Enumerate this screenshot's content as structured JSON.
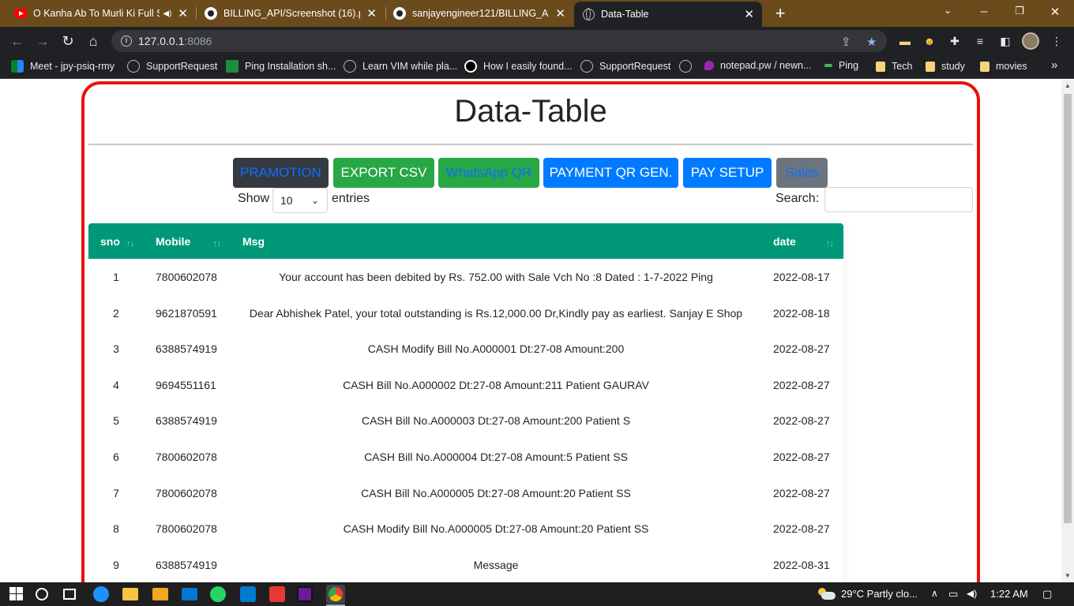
{
  "browser": {
    "tabs": [
      {
        "label": "O Kanha Ab To Murli Ki Full S",
        "icon": "youtube-icon",
        "audio": true
      },
      {
        "label": "BILLING_API/Screenshot (16).png",
        "icon": "github-icon"
      },
      {
        "label": "sanjayengineer121/BILLING_API",
        "icon": "github-icon"
      },
      {
        "label": "Data-Table",
        "icon": "globe-icon",
        "active": true
      }
    ],
    "new_tab": "+",
    "url_host": "127.0.0.1",
    "url_port": ":8086",
    "bookmarks": [
      {
        "label": "Meet - jpy-psiq-rmy",
        "icon": "meet-icon"
      },
      {
        "label": "SupportRequest",
        "icon": "globe-icon"
      },
      {
        "label": "Ping Installation sh...",
        "icon": "sheets-icon"
      },
      {
        "label": "Learn VIM while pla...",
        "icon": "globe-icon"
      },
      {
        "label": "How I easily found...",
        "icon": "medium-icon"
      },
      {
        "label": "SupportRequest",
        "icon": "globe-icon"
      },
      {
        "label": "notepad.pw / newn...",
        "icon": "notepad-icon"
      },
      {
        "label": "Ping",
        "icon": "ping-icon"
      },
      {
        "label": "Tech",
        "icon": "folder-icon"
      },
      {
        "label": "study",
        "icon": "folder-icon"
      },
      {
        "label": "movies",
        "icon": "folder-icon"
      }
    ],
    "more_bookmarks": "»"
  },
  "page": {
    "title": "Data-Table",
    "buttons": {
      "promotion": "PRAMOTION",
      "export_csv": "EXPORT CSV",
      "whatsapp_qr": "WhatsApp QR",
      "payment_qr": "PAYMENT QR GEN.",
      "pay_setup": "PAY SETUP",
      "sales": "Sales"
    },
    "length": {
      "show": "Show",
      "value": "10",
      "entries": "entries"
    },
    "search_label": "Search:",
    "table": {
      "headers": {
        "sno": "sno",
        "mobile": "Mobile",
        "msg": "Msg",
        "date": "date"
      },
      "rows": [
        {
          "sno": "1",
          "mobile": "7800602078",
          "msg": "Your account has been debited by Rs. 752.00 with Sale Vch No :8 Dated : 1-7-2022 Ping",
          "date": "2022-08-17"
        },
        {
          "sno": "2",
          "mobile": "9621870591",
          "msg": "Dear Abhishek Patel, your total outstanding is Rs.12,000.00 Dr,Kindly pay as earliest. Sanjay E Shop",
          "date": "2022-08-18"
        },
        {
          "sno": "3",
          "mobile": "6388574919",
          "msg": "CASH Modify Bill No.A000001 Dt:27-08 Amount:200",
          "date": "2022-08-27"
        },
        {
          "sno": "4",
          "mobile": "9694551161",
          "msg": "CASH Bill No.A000002 Dt:27-08 Amount:211 Patient GAURAV",
          "date": "2022-08-27"
        },
        {
          "sno": "5",
          "mobile": "6388574919",
          "msg": "CASH Bill No.A000003 Dt:27-08 Amount:200 Patient S",
          "date": "2022-08-27"
        },
        {
          "sno": "6",
          "mobile": "7800602078",
          "msg": "CASH Bill No.A000004 Dt:27-08 Amount:5 Patient SS",
          "date": "2022-08-27"
        },
        {
          "sno": "7",
          "mobile": "7800602078",
          "msg": "CASH Bill No.A000005 Dt:27-08 Amount:20 Patient SS",
          "date": "2022-08-27"
        },
        {
          "sno": "8",
          "mobile": "7800602078",
          "msg": "CASH Modify Bill No.A000005 Dt:27-08 Amount:20 Patient SS",
          "date": "2022-08-27"
        },
        {
          "sno": "9",
          "mobile": "6388574919",
          "msg": "Message",
          "date": "2022-08-31"
        }
      ]
    }
  },
  "taskbar": {
    "weather": "29°C  Partly clo...",
    "time": "1:22 AM"
  },
  "colors": {
    "frame_border": "#e8120c",
    "table_header": "#009879",
    "tab_bar": "#6b4a1b"
  }
}
